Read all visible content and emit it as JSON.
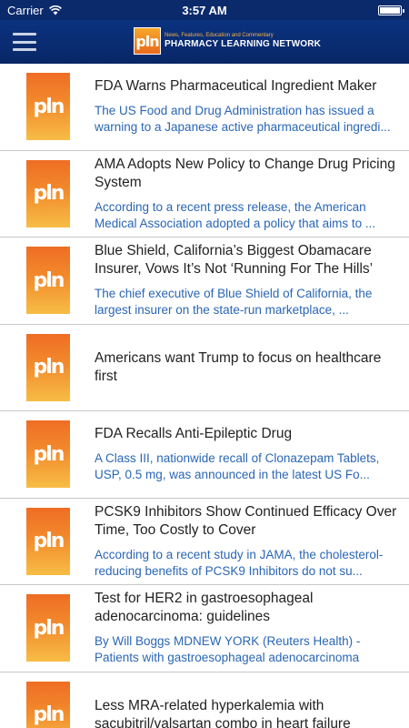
{
  "status_bar": {
    "carrier": "Carrier",
    "time": "3:57 AM"
  },
  "header": {
    "menu_icon": "hamburger-menu-icon",
    "logo_text": "pln",
    "tagline": "News, Features, Education and Commentary",
    "brand_name": "PHARMACY LEARNING NETWORK"
  },
  "colors": {
    "nav_background": "#0b3280",
    "headline_text": "#222222",
    "summary_text": "#2a66b5",
    "thumbnail_top": "#ef6d24",
    "thumbnail_bottom": "#f7bd45"
  },
  "articles": [
    {
      "thumb": "pln",
      "headline": "FDA Warns Pharmaceutical Ingredient Maker",
      "summary": "The US Food and Drug Administration has issued a warning to a Japanese active pharmaceutical ingredi..."
    },
    {
      "thumb": "pln",
      "headline": "AMA Adopts New Policy to Change Drug Pricing System",
      "summary": "According to a recent press release, the American Medical Association adopted a policy that aims to ..."
    },
    {
      "thumb": "pln",
      "headline": "Blue Shield, California’s Biggest Obamacare Insurer, Vows It’s Not ‘Running For The Hills’",
      "summary": "The chief executive of Blue Shield of California, the largest insurer on the state-run marketplace, ..."
    },
    {
      "thumb": "pln",
      "headline": "Americans want Trump to focus on healthcare first",
      "summary": ""
    },
    {
      "thumb": "pln",
      "headline": "FDA Recalls Anti-Epileptic Drug",
      "summary": "A Class III, nationwide recall of Clonazepam Tablets, USP, 0.5 mg, was announced in the latest US Fo..."
    },
    {
      "thumb": "pln",
      "headline": "PCSK9 Inhibitors Show Continued Efficacy Over Time, Too Costly to Cover",
      "summary": "According to a recent study in JAMA, the cholesterol-reducing benefits of PCSK9 Inhibitors do not su..."
    },
    {
      "thumb": "pln",
      "headline": "Test for HER2 in gastroesophageal adenocarcinoma: guidelines",
      "summary": "By Will Boggs MDNEW YORK (Reuters Health) - Patients with gastroesophageal adenocarcinoma"
    },
    {
      "thumb": "pln",
      "headline": "Less MRA-related hyperkalemia with sacubitril/valsartan combo in heart failure",
      "summary": ""
    }
  ]
}
